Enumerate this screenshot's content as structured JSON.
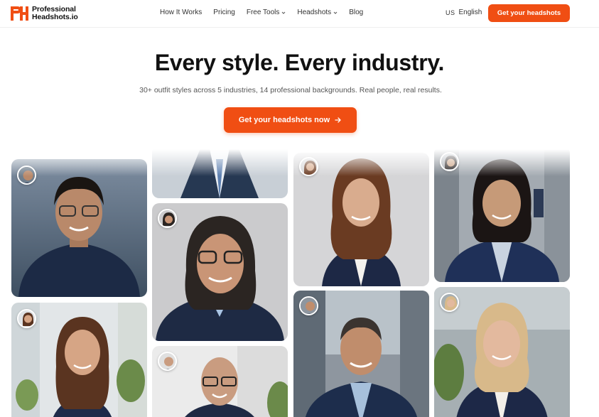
{
  "brand": {
    "line1": "Professional",
    "line2": "Headshots.io",
    "mark": "PH",
    "color": "#f04e13"
  },
  "nav": {
    "items": [
      {
        "label": "How It Works",
        "dropdown": false
      },
      {
        "label": "Pricing",
        "dropdown": false
      },
      {
        "label": "Free Tools",
        "dropdown": true
      },
      {
        "label": "Headshots",
        "dropdown": true
      },
      {
        "label": "Blog",
        "dropdown": false
      }
    ]
  },
  "language": {
    "flag": "US",
    "label": "English"
  },
  "header_cta": "Get your headshots",
  "hero": {
    "title": "Every style. Every industry.",
    "subtitle": "30+ outfit styles across 5 industries, 14 professional backgrounds. Real people, real results.",
    "cta": "Get your headshots now",
    "cta_icon": "arrow-right-icon"
  },
  "gallery": {
    "photos": [
      {
        "name": "young man with glasses in navy polo",
        "bg": "#5d6e80"
      },
      {
        "name": "woman with glasses in navy blazer",
        "bg": "#c9c9cb"
      },
      {
        "name": "woman with wavy hair in navy blazer",
        "bg": "#d4d4d6"
      },
      {
        "name": "woman in navy blazer on street",
        "bg": "#9aa2ab"
      },
      {
        "name": "woman with long hair in office",
        "bg": "#dfe3e6"
      },
      {
        "name": "bald man with glasses",
        "bg": "#e6e6e6"
      },
      {
        "name": "man in navy blazer on city street",
        "bg": "#8b939c"
      },
      {
        "name": "blonde woman in navy blazer",
        "bg": "#9fa8ad"
      }
    ]
  }
}
